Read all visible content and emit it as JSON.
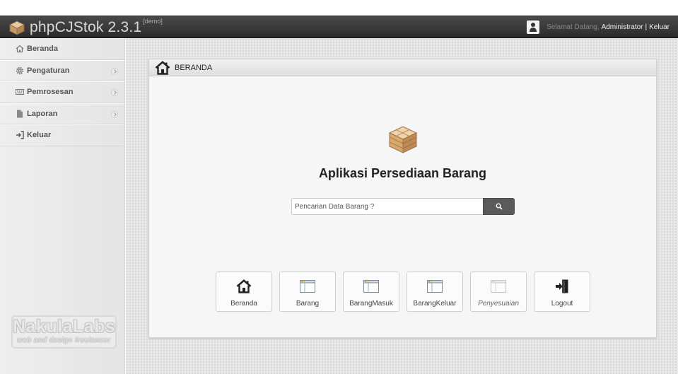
{
  "app": {
    "title": "phpCJStok 2.3.1",
    "badge": "[demo]"
  },
  "topbar": {
    "welcome": "Selamat Datang,",
    "user_name": "Administrator",
    "separator": "|",
    "logout": "Keluar"
  },
  "sidebar": {
    "items": [
      {
        "label": "Beranda",
        "icon": "home-icon",
        "has_submenu": false
      },
      {
        "label": "Pengaturan",
        "icon": "gear-icon",
        "has_submenu": true
      },
      {
        "label": "Pemrosesan",
        "icon": "keyboard-icon",
        "has_submenu": true
      },
      {
        "label": "Laporan",
        "icon": "document-icon",
        "has_submenu": true
      },
      {
        "label": "Keluar",
        "icon": "sign-out-icon",
        "has_submenu": false
      }
    ],
    "brand_logo_title": "NakulaLabs",
    "brand_logo_sub": "web and design freelancer"
  },
  "panel": {
    "title": "BERANDA",
    "heading": "Aplikasi Persediaan Barang",
    "search": {
      "placeholder": "Pencarian Data Barang ?"
    },
    "shortcuts": [
      {
        "label": "Beranda",
        "icon": "home-icon"
      },
      {
        "label": "Barang",
        "icon": "window-icon"
      },
      {
        "label": "BarangMasuk",
        "icon": "window-icon"
      },
      {
        "label": "BarangKeluar",
        "icon": "window-icon"
      },
      {
        "label": "Penyesuaian",
        "icon": "window-icon",
        "disabled": true
      },
      {
        "label": "Logout",
        "icon": "sign-out-icon"
      }
    ]
  },
  "colors": {
    "topbar": "#2c2c2c",
    "sidebar": "#e8e8e8",
    "search_button": "#5a5a5a",
    "panel": "#f6f6f6"
  }
}
